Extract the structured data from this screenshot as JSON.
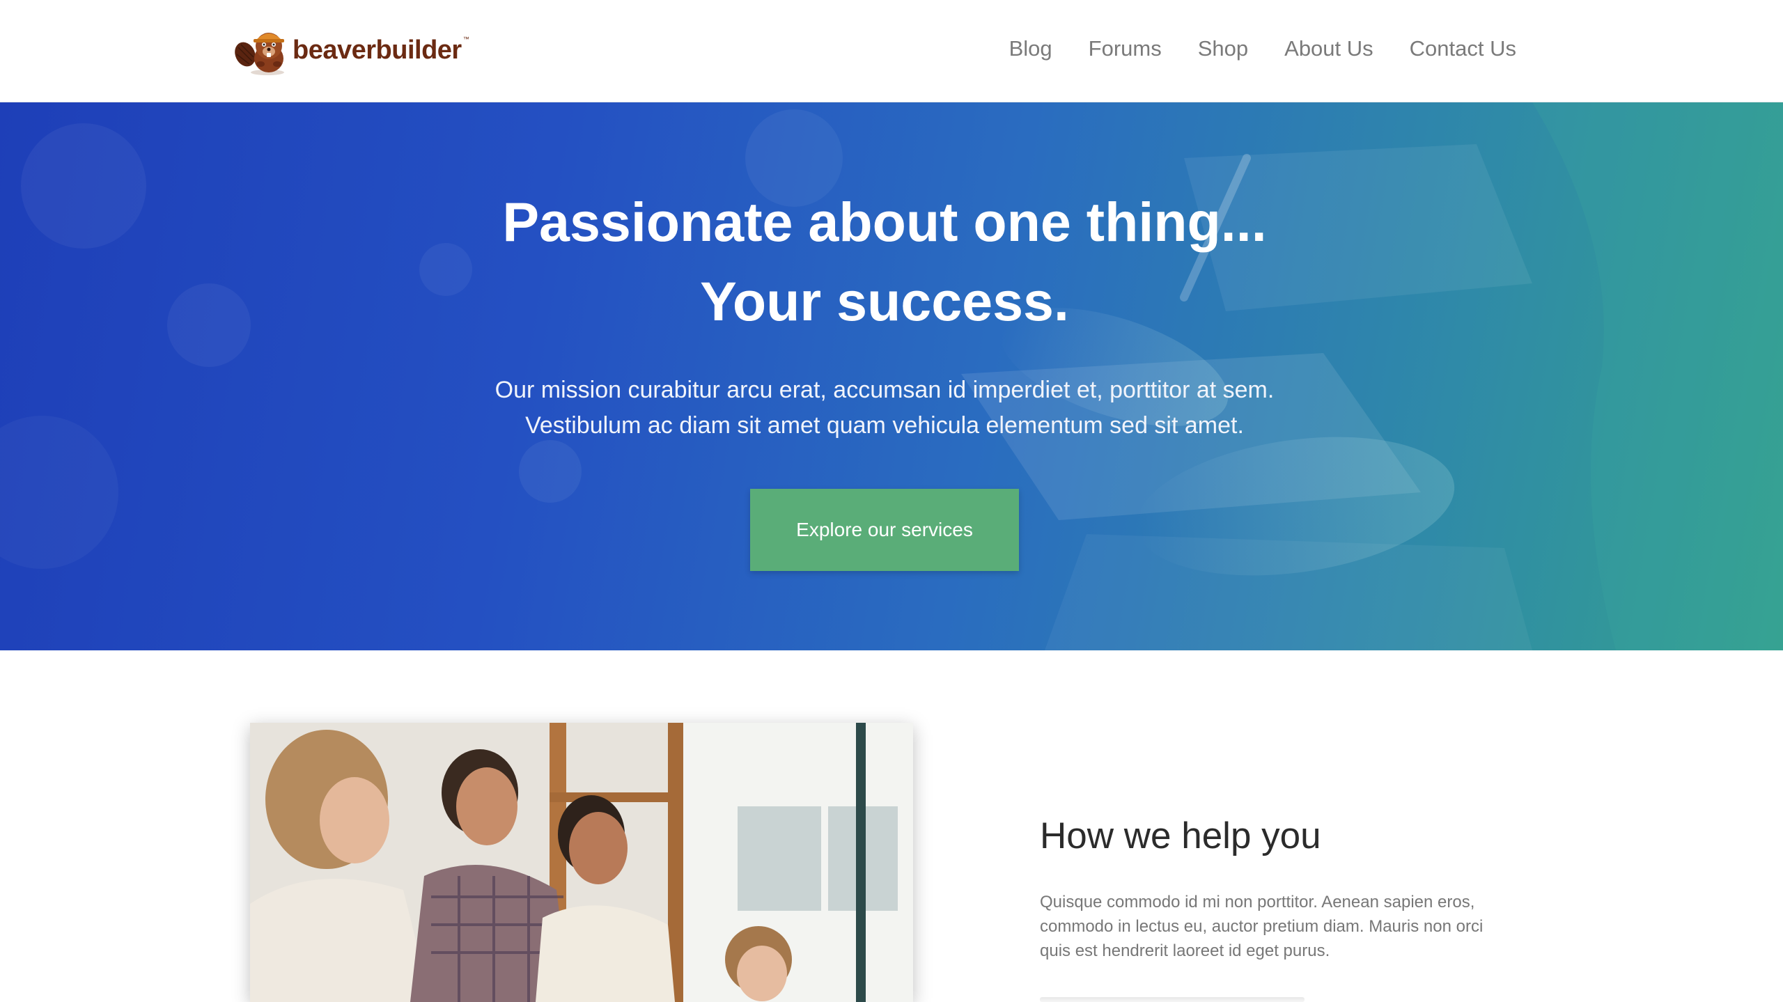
{
  "header": {
    "logo": {
      "text": "beaverbuilder",
      "tm": "™"
    },
    "nav": [
      {
        "label": "Blog"
      },
      {
        "label": "Forums"
      },
      {
        "label": "Shop"
      },
      {
        "label": "About Us"
      },
      {
        "label": "Contact Us"
      }
    ]
  },
  "hero": {
    "title_line1": "Passionate about one thing...",
    "title_line2": "Your success.",
    "subtitle_line1": "Our mission curabitur arcu erat, accumsan id imperdiet et, porttitor at sem.",
    "subtitle_line2": "Vestibulum ac diam sit amet quam vehicula elementum sed sit amet.",
    "cta_label": "Explore our services"
  },
  "content": {
    "heading": "How we help you",
    "body_line1": "Quisque commodo id mi non porttitor. Aenean sapien eros,",
    "body_line2": "commodo in lectus eu, auctor pretium diam. Mauris non orci",
    "body_line3": "quis est hendrerit laoreet id eget purus."
  },
  "colors": {
    "brand": "#6b2a12",
    "hero_start": "#1e3fb8",
    "hero_end": "#34a18e",
    "cta": "#5aad78",
    "nav_text": "#7a7a7a"
  },
  "icons": {
    "logo": "beaver-logo-icon"
  }
}
